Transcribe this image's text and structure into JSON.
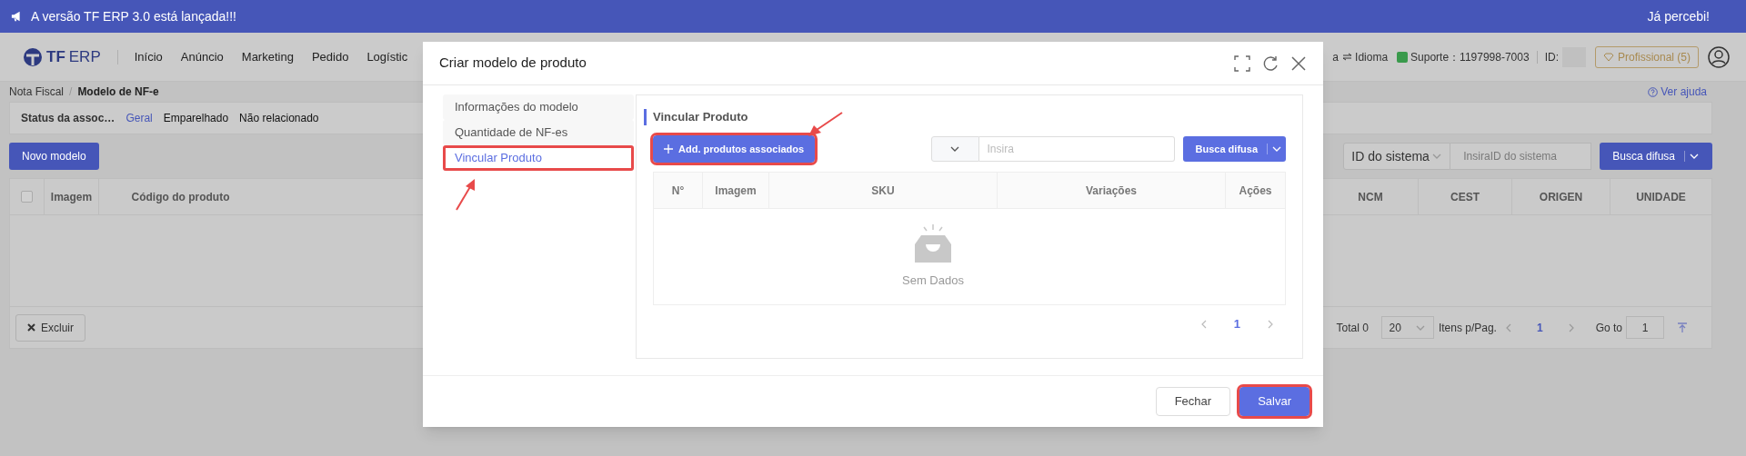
{
  "banner": {
    "text": "A versão TF ERP 3.0 está lançada!!!",
    "dismiss": "Já percebi!"
  },
  "header": {
    "logo_mark": "TF",
    "logo_text": "ERP",
    "nav": [
      "Início",
      "Anúncio",
      "Marketing",
      "Pedido",
      "Logístic"
    ],
    "cut_text": "a",
    "language": "Idioma",
    "support": "Suporte：1197998-7003",
    "id_label": "ID:",
    "plan": "Profissional (5)"
  },
  "breadcrumb": [
    "Nota Fiscal",
    "/",
    "Modelo de NF-e"
  ],
  "help": "Ver ajuda",
  "filter": {
    "label": "Status da assoc…",
    "options": [
      {
        "label": "Geral",
        "selected": true
      },
      {
        "label": "Emparelhado",
        "selected": false
      },
      {
        "label": "Não relacionado",
        "selected": false
      }
    ]
  },
  "new_button": "Novo modelo",
  "search": {
    "field": "ID do sistema",
    "placeholder": "InsiraID do sistema",
    "button": "Busca difusa"
  },
  "table": {
    "select_all_checked": false,
    "columns": [
      "Imagem",
      "Código do produto",
      "NCM",
      "CEST",
      "ORIGEN",
      "UNIDADE"
    ]
  },
  "footer": {
    "delete": "Excluir",
    "total": "Total 0",
    "page_size": "20",
    "per_page": "Itens p/Pag.",
    "page": "1",
    "goto": "Go to",
    "goto_value": "1"
  },
  "modal": {
    "title": "Criar modelo de produto",
    "menu": [
      {
        "label": "Informações do modelo",
        "selected": false,
        "highlighted": false
      },
      {
        "label": "Quantidade de NF-es",
        "selected": false,
        "highlighted": false
      },
      {
        "label": "Vincular Produto",
        "selected": true,
        "highlighted": true
      }
    ],
    "section_title": "Vincular Produto",
    "add_button": {
      "label": "Add. produtos associados",
      "highlighted": true
    },
    "search": {
      "placeholder": "Insira",
      "button": "Busca difusa"
    },
    "columns": [
      "N°",
      "Imagem",
      "SKU",
      "Variações",
      "Ações"
    ],
    "empty": "Sem Dados",
    "page": "1",
    "buttons": [
      {
        "label": "Fechar",
        "kind": "default",
        "highlighted": false
      },
      {
        "label": "Salvar",
        "kind": "primary",
        "highlighted": true
      }
    ]
  }
}
